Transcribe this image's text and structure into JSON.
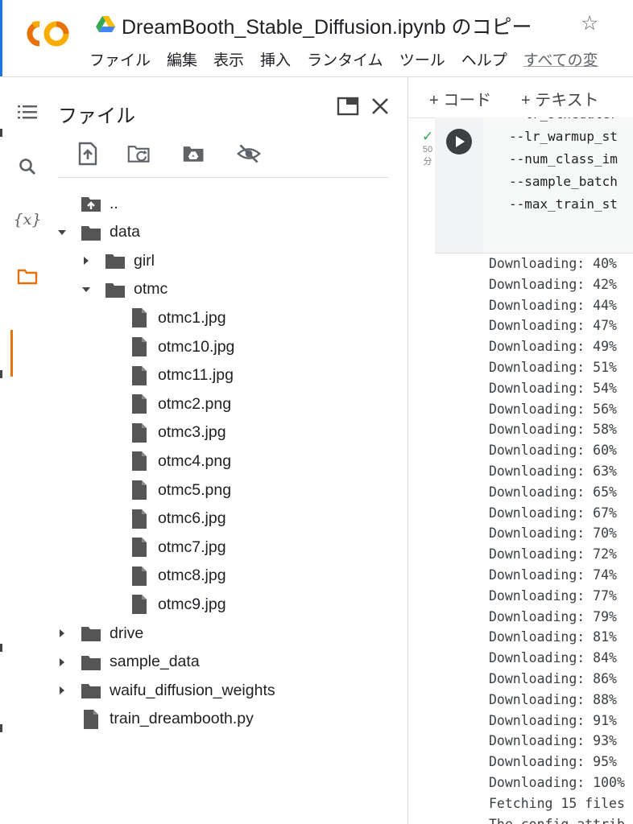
{
  "window": {
    "title": "DreamBooth_Stable_Diffusion.ipynb のコピー",
    "logo_text": "CO"
  },
  "menu": {
    "items": [
      "ファイル",
      "編集",
      "表示",
      "挿入",
      "ランタイム",
      "ツール",
      "ヘルプ"
    ],
    "changes_link": "すべての変"
  },
  "panel": {
    "title": "ファイル",
    "tree": [
      {
        "label": "..",
        "type": "up",
        "depth": 0,
        "chevron": "none"
      },
      {
        "label": "data",
        "type": "folder",
        "depth": 0,
        "chevron": "open"
      },
      {
        "label": "girl",
        "type": "folder",
        "depth": 1,
        "chevron": "closed"
      },
      {
        "label": "otmc",
        "type": "folder",
        "depth": 1,
        "chevron": "open"
      },
      {
        "label": "otmc1.jpg",
        "type": "file",
        "depth": 2,
        "chevron": "none"
      },
      {
        "label": "otmc10.jpg",
        "type": "file",
        "depth": 2,
        "chevron": "none"
      },
      {
        "label": "otmc11.jpg",
        "type": "file",
        "depth": 2,
        "chevron": "none"
      },
      {
        "label": "otmc2.png",
        "type": "file",
        "depth": 2,
        "chevron": "none"
      },
      {
        "label": "otmc3.jpg",
        "type": "file",
        "depth": 2,
        "chevron": "none"
      },
      {
        "label": "otmc4.png",
        "type": "file",
        "depth": 2,
        "chevron": "none"
      },
      {
        "label": "otmc5.png",
        "type": "file",
        "depth": 2,
        "chevron": "none"
      },
      {
        "label": "otmc6.jpg",
        "type": "file",
        "depth": 2,
        "chevron": "none"
      },
      {
        "label": "otmc7.jpg",
        "type": "file",
        "depth": 2,
        "chevron": "none"
      },
      {
        "label": "otmc8.jpg",
        "type": "file",
        "depth": 2,
        "chevron": "none"
      },
      {
        "label": "otmc9.jpg",
        "type": "file",
        "depth": 2,
        "chevron": "none"
      },
      {
        "label": "drive",
        "type": "folder",
        "depth": 0,
        "chevron": "closed"
      },
      {
        "label": "sample_data",
        "type": "folder",
        "depth": 0,
        "chevron": "closed"
      },
      {
        "label": "waifu_diffusion_weights",
        "type": "folder",
        "depth": 0,
        "chevron": "closed"
      },
      {
        "label": "train_dreambooth.py",
        "type": "file",
        "depth": 0,
        "chevron": "none"
      }
    ]
  },
  "notebook": {
    "add_code": "+ コード",
    "add_text": "+ テキスト",
    "cell_status": {
      "check": "✓",
      "elapsed": "50",
      "unit": "分"
    },
    "code_lines": [
      "--lr_scheduler",
      "--lr_warmup_st",
      "--num_class_im",
      "--sample_batch",
      "--max_train_st"
    ],
    "output_lines": [
      "Downloading:  40%",
      "Downloading:  42%",
      "Downloading:  44%",
      "Downloading:  47%",
      "Downloading:  49%",
      "Downloading:  51%",
      "Downloading:  54%",
      "Downloading:  56%",
      "Downloading:  58%",
      "Downloading:  60%",
      "Downloading:  63%",
      "Downloading:  65%",
      "Downloading:  67%",
      "Downloading:  70%",
      "Downloading:  72%",
      "Downloading:  74%",
      "Downloading:  77%",
      "Downloading:  79%",
      "Downloading:  81%",
      "Downloading:  84%",
      "Downloading:  86%",
      "Downloading:  88%",
      "Downloading:  91%",
      "Downloading:  93%",
      "Downloading:  95%",
      "Downloading: 100%",
      "Fetching 15 files",
      "The config attrib"
    ]
  },
  "colors": {
    "accent_orange": "#e8710a",
    "logo_orange": "#f9ab00",
    "icon_gray": "#5f6368",
    "check_green": "#34a853"
  }
}
